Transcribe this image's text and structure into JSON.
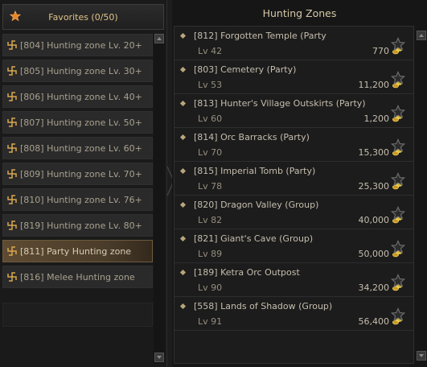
{
  "favorites": {
    "label": "Favorites (0/50)"
  },
  "categories": [
    {
      "label": "[804] Hunting zone Lv. 20+",
      "selected": false
    },
    {
      "label": "[805] Hunting zone Lv. 30+",
      "selected": false
    },
    {
      "label": "[806] Hunting zone Lv. 40+",
      "selected": false
    },
    {
      "label": "[807] Hunting zone Lv. 50+",
      "selected": false
    },
    {
      "label": "[808] Hunting zone Lv. 60+",
      "selected": false
    },
    {
      "label": "[809] Hunting zone Lv. 70+",
      "selected": false
    },
    {
      "label": "[810] Hunting zone Lv. 76+",
      "selected": false
    },
    {
      "label": "[819] Hunting zone Lv. 80+",
      "selected": false
    },
    {
      "label": "[811] Party Hunting zone",
      "selected": true
    },
    {
      "label": "[816] Melee Hunting zone",
      "selected": false
    }
  ],
  "panel": {
    "title": "Hunting Zones"
  },
  "zones": [
    {
      "name": "[812] Forgotten Temple (Party",
      "level": "Lv 42",
      "price": "770"
    },
    {
      "name": "[803] Cemetery (Party)",
      "level": "Lv 53",
      "price": "11,200"
    },
    {
      "name": "[813] Hunter's Village Outskirts (Party)",
      "level": "Lv 60",
      "price": "1,200"
    },
    {
      "name": "[814] Orc Barracks (Party)",
      "level": "Lv 70",
      "price": "15,300"
    },
    {
      "name": "[815] Imperial Tomb (Party)",
      "level": "Lv 78",
      "price": "25,300"
    },
    {
      "name": "[820] Dragon Valley (Group)",
      "level": "Lv 82",
      "price": "40,000"
    },
    {
      "name": "[821] Giant's Cave (Group)",
      "level": "Lv 89",
      "price": "50,000"
    },
    {
      "name": "[189] Ketra Orc Outpost",
      "level": "Lv 90",
      "price": "34,200"
    },
    {
      "name": "[558] Lands of Shadow (Group)",
      "level": "Lv 91",
      "price": "56,400"
    }
  ],
  "colors": {
    "accent": "#e2c48a",
    "selected": "#5d4a32",
    "coin": "#e0b830"
  }
}
